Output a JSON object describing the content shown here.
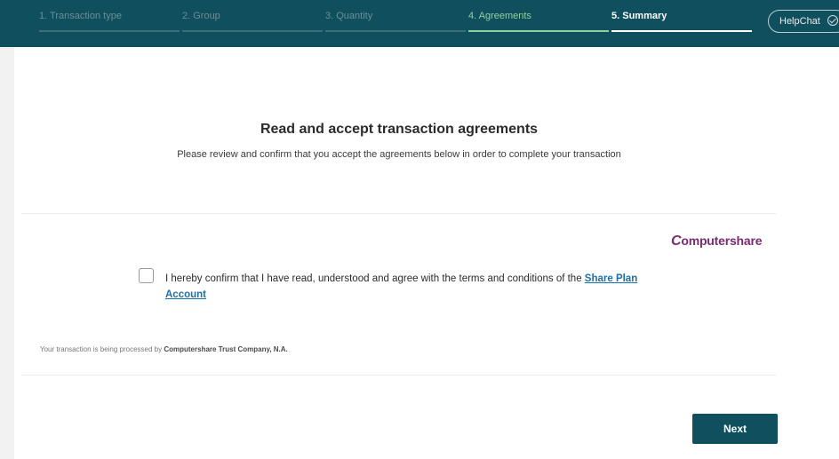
{
  "steps": [
    {
      "label": "1. Transaction type"
    },
    {
      "label": "2. Group"
    },
    {
      "label": "3. Quantity"
    },
    {
      "label": "4. Agreements"
    },
    {
      "label": "5. Summary"
    }
  ],
  "helpchat": {
    "label": "HelpChat"
  },
  "page": {
    "title": "Read and accept transaction agreements",
    "subtitle": "Please review and confirm that you accept the agreements below in order to complete your transaction"
  },
  "agreement": {
    "logo_initial": "C",
    "logo_rest": "omputershare",
    "text": "I hereby confirm that I have read, understood and agree with the terms and conditions of the ",
    "link": "Share Plan Account",
    "checked": false
  },
  "footer": {
    "prefix": "Your transaction is being processed by ",
    "company": "Computershare Trust Company, N.A."
  },
  "actions": {
    "next_label": "Next"
  },
  "colors": {
    "brand": "#0f4f5e",
    "active_step": "#8fd19e",
    "logo": "#7a2a6e",
    "link": "#1f6fa8"
  }
}
